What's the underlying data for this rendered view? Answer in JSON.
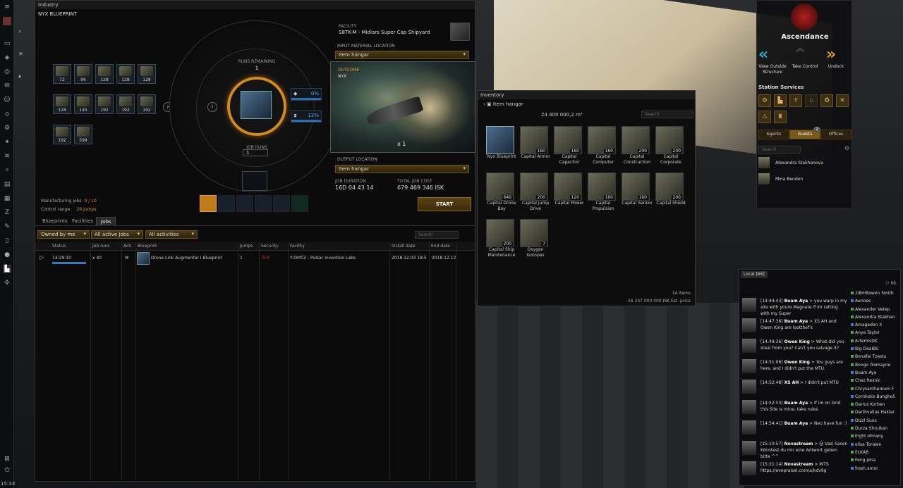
{
  "clock": "15:33",
  "industry": {
    "window_title": "Industry",
    "blueprint_title": "NYX BLUEPRINT",
    "input_quantities": [
      "72",
      "96",
      "128",
      "128",
      "128",
      "128",
      "145",
      "192",
      "192",
      "192",
      "192",
      "599"
    ],
    "runs_remaining_label": "RUNS REMAINING",
    "runs_remaining_value": "1",
    "job_runs_label": "JOB RUNS",
    "job_runs_value": "1",
    "material_efficiency": "0%",
    "time_efficiency": "12%",
    "facility_label": "FACILITY",
    "facility_value": "S8TK-M - Midlars Super Cap Shipyard",
    "input_location_label": "INPUT MATERIAL LOCATION",
    "input_location_value": "Item hangar",
    "outcome_label": "OUTCOME",
    "outcome_name": "NYX",
    "outcome_qty": "x 1",
    "output_location_label": "OUTPUT LOCATION",
    "output_location_value": "Item hangar",
    "job_duration_label": "JOB DURATION",
    "job_duration_value": "16D 04 43 14",
    "total_cost_label": "TOTAL JOB COST",
    "total_cost_value": "679 469 346 ISK",
    "manufacturing_jobs_label": "Manufacturing jobs",
    "manufacturing_jobs_value": "0 / 10",
    "control_range_label": "Control range",
    "control_range_value": "20 Jumps",
    "start_label": "START",
    "tabs": [
      "Blueprints",
      "Facilities",
      "Jobs"
    ],
    "filters": [
      "Owned by me",
      "All active Jobs",
      "All activities"
    ],
    "search_placeholder": "Search",
    "columns": [
      "Status",
      "Job runs",
      "Acti",
      "Blueprint",
      "Jumps",
      "Security",
      "Facility",
      "Install date",
      "End date"
    ],
    "job": {
      "status": "14:29:10",
      "runs": "x 40",
      "blueprint": "Drone Link Augmentor I Blueprint",
      "jumps": "1",
      "security": "-0.0",
      "facility": "Y-OMTZ - Pulsar Invention Labs",
      "install_date": "2018.12.03 18:5",
      "end_date": "2018.12.12"
    }
  },
  "inventory": {
    "window_title": "Inventory",
    "tree_label": "Item hangar",
    "capacity": "24 400 000,2 m³",
    "search_placeholder": "Search",
    "items": [
      {
        "name": "Nyx Blueprint",
        "qty": ""
      },
      {
        "name": "Capital Armor",
        "qty": "160"
      },
      {
        "name": "Capital Capacitor",
        "qty": "160"
      },
      {
        "name": "Capital Computer",
        "qty": "160"
      },
      {
        "name": "Capital Construction",
        "qty": "200"
      },
      {
        "name": "Capital Corporate",
        "qty": "200"
      },
      {
        "name": "Capital Drone Bay",
        "qty": "640"
      },
      {
        "name": "Capital Jump Drive",
        "qty": "200"
      },
      {
        "name": "Capital Power",
        "qty": "120"
      },
      {
        "name": "Capital Propulsion",
        "qty": "160"
      },
      {
        "name": "Capital Sensor",
        "qty": "160"
      },
      {
        "name": "Capital Shield",
        "qty": "200"
      },
      {
        "name": "Capital Ship Maintenance",
        "qty": "200"
      },
      {
        "name": "Oxygen Isotopes",
        "qty": "7"
      }
    ],
    "item_count": "14 items",
    "est_price": "16 237 000 000 ISK Est. price"
  },
  "station": {
    "name": "Ascendance",
    "actions": [
      "View Outside Structure",
      "Take Control",
      "Undock"
    ],
    "services_label": "Station Services",
    "tabs": [
      "Agents",
      "Guests",
      "Offices"
    ],
    "guests_badge": "2",
    "search_placeholder": "Search",
    "guests": [
      "Alexandra Stakhanova",
      "Mina Benden"
    ]
  },
  "chat": {
    "tab_label": "Local [66]",
    "member_count": "66",
    "messages": [
      {
        "time": "[14:44:43]",
        "who": "Buam Aya",
        "text": " > you warp in my site with youre Magnate if im ratting with my Super"
      },
      {
        "time": "[14:47:38]",
        "who": "Buam Aya",
        "text": " > XS AH and Owen King are lootthef's"
      },
      {
        "time": "[14:49:36]",
        "who": "Owen King",
        "text": " > What did you steal from you? Can't you salvage it?"
      },
      {
        "time": "[14:51:06]",
        "who": "Owen King",
        "text": " > You guys are here, and I didn't put the MTU."
      },
      {
        "time": "[14:52:48]",
        "who": "XS AH",
        "text": " > I didn't put MTU"
      },
      {
        "time": "[14:52:53]",
        "who": "Buam Aya",
        "text": " > If im on Grid this Site is mine, take rules"
      },
      {
        "time": "[14:54:41]",
        "who": "Buam Aya",
        "text": " > Neo have fun :)"
      },
      {
        "time": "[15:10:57]",
        "who": "Novastream",
        "text": " > @ Vasi Sasen Könntest du mir eine Antwort geben bitte ^^"
      },
      {
        "time": "[15:21:14]",
        "who": "Novastream",
        "text": " > WTS https://evepraisal.com/a/kdv9g"
      }
    ],
    "members": [
      "2l8mBowen Smith",
      "Aeriose",
      "Alexander Vetep",
      "Alexandra Stakhan",
      "Amagedon II",
      "Anya Taylor",
      "ArtemisDK",
      "Big DeaIBS",
      "Bonafai Tzestu",
      "Bongo Tremayne",
      "Buam Aya",
      "Chaz Resnic",
      "Chrysanthemum F",
      "Cornholio Bungholi",
      "Darius Korben",
      "Darthvalius Haklar",
      "Dizzl Suxx",
      "Durza Shruikan",
      "Eight ofmany",
      "elisa Toralen",
      "ELKAB",
      "Feng pina",
      "fresh amor"
    ]
  }
}
